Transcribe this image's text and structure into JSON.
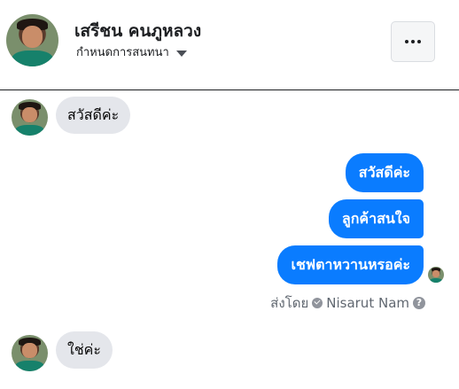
{
  "header": {
    "name": "เสรีชน คนภูหลวง",
    "subtitle": "กำหนดการสนทนา",
    "avatar_icon": "user-avatar",
    "more_icon": "ellipsis-icon"
  },
  "messages": [
    {
      "direction": "in",
      "text": "สวัสดีค่ะ"
    },
    {
      "direction": "out",
      "text": "สวัสดีค่ะ"
    },
    {
      "direction": "out",
      "text": "ลูกค้าสนใจ"
    },
    {
      "direction": "out",
      "text": "เชฟตาหวานหรอค่ะ"
    },
    {
      "direction": "in",
      "text": "ใช่ค่ะ"
    }
  ],
  "sent_by": {
    "prefix": "ส่งโดย",
    "name": "Nisarut Nam",
    "help_glyph": "?"
  },
  "colors": {
    "outgoing_bubble": "#0a7cff",
    "incoming_bubble": "#e4e6eb",
    "divider": "#1c1e21"
  }
}
